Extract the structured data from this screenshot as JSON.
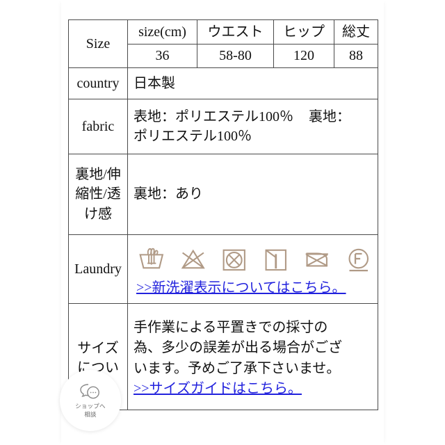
{
  "colors": {
    "page_background": "#ffffff",
    "table_border": "#4a4a4a",
    "text": "#111111",
    "link": "#2222dd",
    "laundry_symbol": "#b09a86",
    "widget_text": "#6b6b6b"
  },
  "table": {
    "size_header": {
      "label": "Size",
      "columns": [
        "size(cm)",
        "ウエスト",
        "ヒップ",
        "総丈"
      ],
      "values": [
        "36",
        "58-80",
        "120",
        "88"
      ]
    },
    "rows": [
      {
        "label": "country",
        "value": "日本製"
      },
      {
        "label": "fabric",
        "line1": "表地：ポリエステル100％",
        "line1_tail": "裏地：",
        "line2": "ポリエステル100％"
      },
      {
        "label": "裏地/伸縮性/透け感",
        "value": "裏地：あり"
      },
      {
        "label": "Laundry",
        "symbols": [
          "hand-wash-tub-icon",
          "do-not-bleach-icon",
          "do-not-tumble-dry-icon",
          "drip-dry-in-shade-icon",
          "do-not-iron-icon",
          "dry-clean-petroleum-solvent-mild-icon"
        ],
        "link": ">>新洗濯表示についてはこちら。"
      },
      {
        "label": "サイズについ",
        "note_lines": [
          "手作業による平置きでの採寸の",
          "為、多少の誤差が出る場合がござ",
          "います。予めご了承下さいませ。"
        ],
        "link": ">>サイズガイドはこちら。"
      }
    ]
  },
  "chat_widget": {
    "icon": "speech-bubbles-icon",
    "line1": "ショップへ",
    "line2": "相談"
  }
}
